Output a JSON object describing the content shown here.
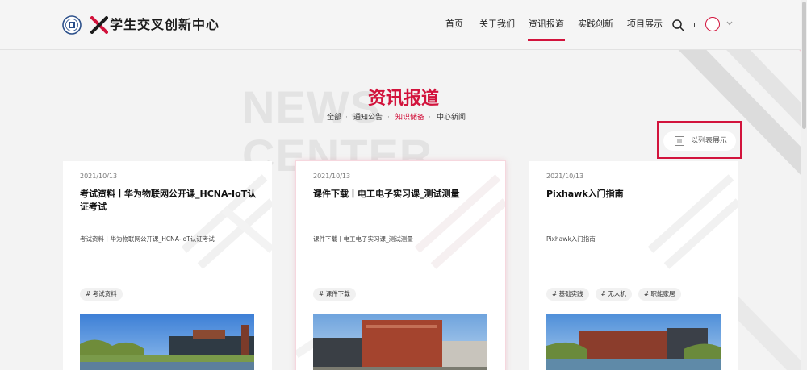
{
  "header": {
    "logo_text": "学生交叉创新中心",
    "nav": [
      {
        "label": "首页"
      },
      {
        "label": "关于我们"
      },
      {
        "label": "资讯报道"
      },
      {
        "label": "实践创新"
      },
      {
        "label": "项目展示"
      }
    ],
    "active_nav": "资讯报道",
    "icons": [
      "search-icon",
      "chevron-down-icon"
    ]
  },
  "section": {
    "bg_title": "NEWS CENTER",
    "title": "资讯报道",
    "filters": [
      {
        "label": "全部"
      },
      {
        "label": "通知公告"
      },
      {
        "label": "知识储备"
      },
      {
        "label": "中心新闻"
      }
    ],
    "filter_sep": "·",
    "active_filter": "知识储备",
    "list_toggle_label": "以列表展示"
  },
  "cards": [
    {
      "date": "2021/10/13",
      "title": "考试资料丨华为物联网公开课_HCNA-IoT认证考试",
      "desc": "考试资料丨华为物联网公开课_HCNA-IoT认证考试",
      "tags": [
        "# 考试资料"
      ]
    },
    {
      "date": "2021/10/13",
      "title": "课件下载丨电工电子实习课_测试测量",
      "desc": "课件下载丨电工电子实习课_测试测量",
      "tags": [
        "# 课件下载"
      ]
    },
    {
      "date": "2021/10/13",
      "title": "Pixhawk入门指南",
      "desc": "Pixhawk入门指南",
      "tags": [
        "# 基础实践",
        "# 无人机",
        "# 职能家居"
      ]
    }
  ],
  "colors": {
    "accent": "#d2133c",
    "background": "#f3f3f3",
    "card": "#ffffff"
  }
}
